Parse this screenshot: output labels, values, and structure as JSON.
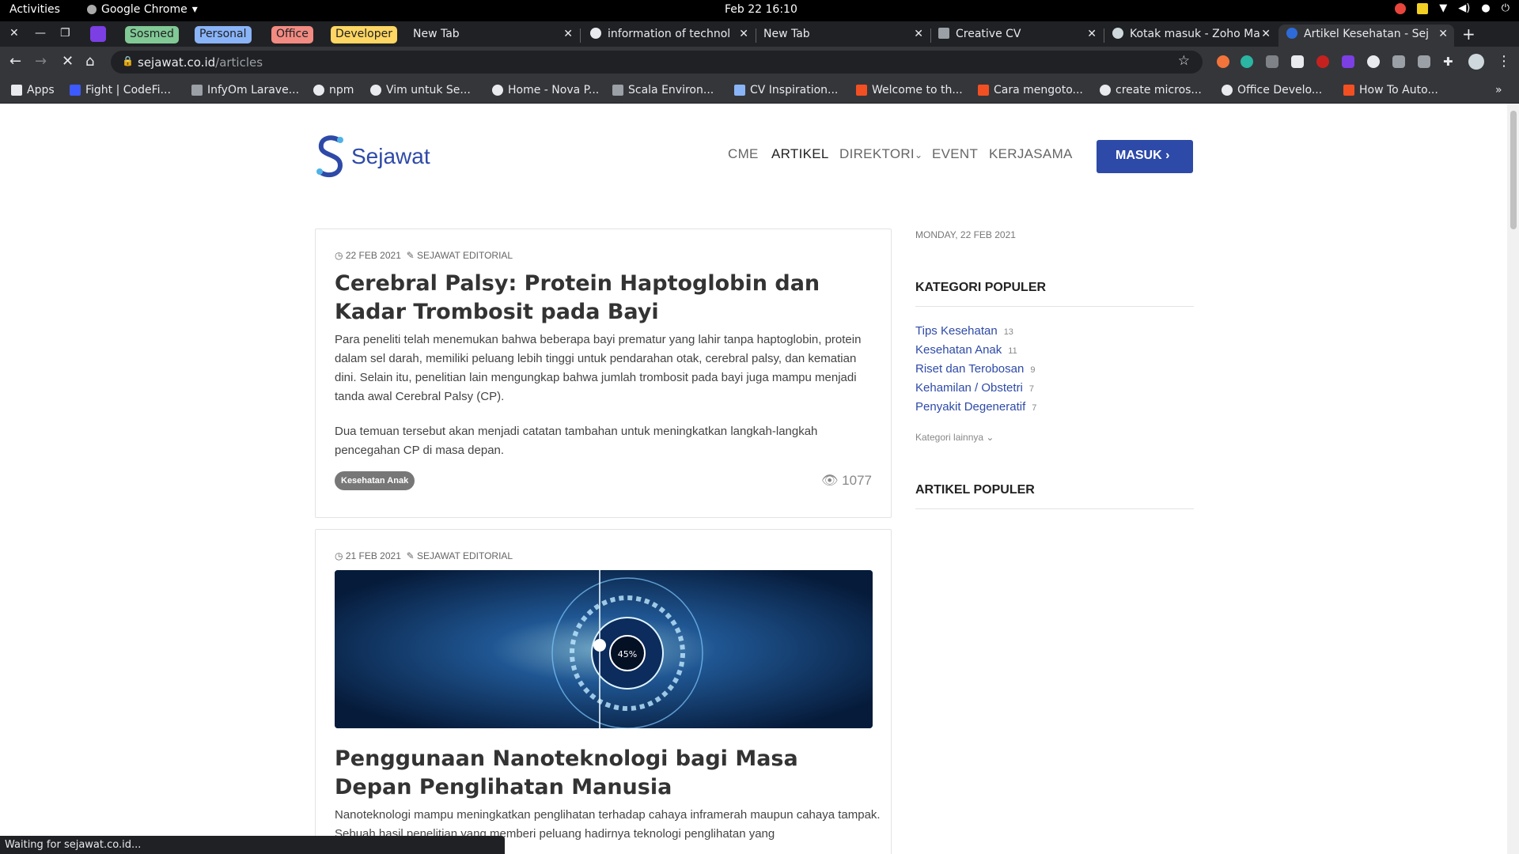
{
  "os": {
    "activities": "Activities",
    "app": "Google Chrome",
    "clock": "Feb 22  16:10"
  },
  "tab_groups": [
    {
      "label": "Sosmed",
      "color": "#81c995"
    },
    {
      "label": "Personal",
      "color": "#8ab4f8"
    },
    {
      "label": "Office",
      "color": "#f28b82"
    },
    {
      "label": "Developer",
      "color": "#fdd663"
    }
  ],
  "tabs": [
    {
      "title": "New Tab"
    },
    {
      "title": "information of technol"
    },
    {
      "title": "New Tab"
    },
    {
      "title": "Creative CV"
    },
    {
      "title": "Kotak masuk - Zoho Ma"
    },
    {
      "title": "Artikel Kesehatan - Sej"
    }
  ],
  "address": {
    "host": "sejawat.co.id",
    "path": "/articles"
  },
  "bookmarks": [
    {
      "label": "Apps"
    },
    {
      "label": "Fight | CodeFi..."
    },
    {
      "label": "InfyOm Larave..."
    },
    {
      "label": "npm"
    },
    {
      "label": "Vim untuk Se..."
    },
    {
      "label": "Home - Nova P..."
    },
    {
      "label": "Scala Environ..."
    },
    {
      "label": "CV Inspiration..."
    },
    {
      "label": "Welcome to th..."
    },
    {
      "label": "Cara mengoto..."
    },
    {
      "label": "create micros..."
    },
    {
      "label": "Office Develo..."
    },
    {
      "label": "How To Auto..."
    }
  ],
  "site": {
    "brand": "Sejawat",
    "nav": [
      "CME",
      "ARTIKEL",
      "DIREKTORI",
      "EVENT",
      "KERJASAMA"
    ],
    "login": "MASUK ›"
  },
  "articles": [
    {
      "date": "22 FEB 2021",
      "author": "SEJAWAT EDITORIAL",
      "title": "Cerebral Palsy: Protein Haptoglobin dan Kadar Trombosit pada Bayi",
      "p1": "Para peneliti telah menemukan bahwa beberapa bayi prematur yang lahir tanpa haptoglobin, protein dalam sel darah, memiliki peluang lebih tinggi untuk pendarahan otak, cerebral palsy, dan kematian dini. Selain itu, penelitian lain mengungkap bahwa jumlah trombosit pada bayi juga mampu menjadi tanda awal Cerebral Palsy (CP).",
      "p2": "Dua temuan tersebut akan menjadi catatan tambahan untuk meningkatkan langkah-langkah pencegahan CP di masa depan.",
      "tag": "Kesehatan Anak",
      "views": "1077"
    },
    {
      "date": "21 FEB 2021",
      "author": "SEJAWAT EDITORIAL",
      "image_label": "45%",
      "title": "Penggunaan Nanoteknologi bagi Masa Depan Penglihatan Manusia",
      "p1": "Nanoteknologi mampu meningkatkan penglihatan terhadap cahaya inframerah maupun cahaya tampak. Sebuah hasil penelitian yang memberi peluang hadirnya teknologi penglihatan yang"
    }
  ],
  "sidebar": {
    "date": "MONDAY, 22 FEB 2021",
    "kategori_title": "KATEGORI POPULER",
    "categories": [
      {
        "name": "Tips Kesehatan",
        "count": "13"
      },
      {
        "name": "Kesehatan Anak",
        "count": "11"
      },
      {
        "name": "Riset dan Terobosan",
        "count": "9"
      },
      {
        "name": "Kehamilan / Obstetri",
        "count": "7"
      },
      {
        "name": "Penyakit Degeneratif",
        "count": "7"
      }
    ],
    "more": "Kategori lainnya ⌄",
    "artikel_title": "ARTIKEL POPULER"
  },
  "status": "Waiting for sejawat.co.id..."
}
